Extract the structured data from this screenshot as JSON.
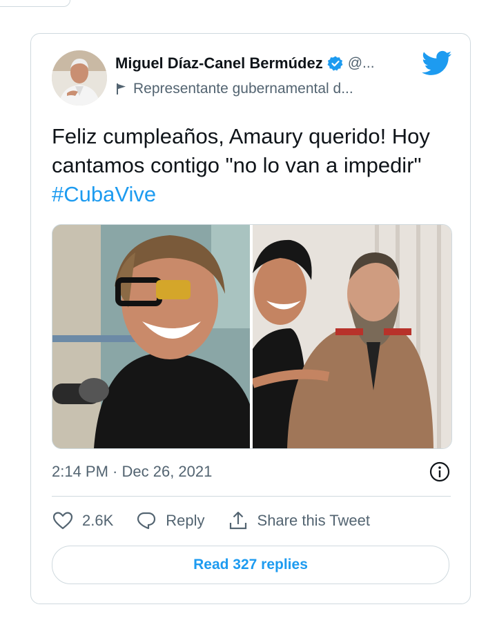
{
  "author": {
    "name": "Miguel Díaz-Canel Bermúdez",
    "handle": "@...",
    "label": "Representante gubernamental d..."
  },
  "tweet": {
    "text": "Feliz cumpleaños, Amaury querido! Hoy cantamos contigo \"no lo van a impedir\"",
    "hashtag": "#CubaVive",
    "timestamp": "2:14 PM · Dec 26, 2021"
  },
  "actions": {
    "likes": "2.6K",
    "reply": "Reply",
    "share": "Share this Tweet"
  },
  "read_replies": "Read 327 replies",
  "colors": {
    "accent": "#1d9bf0",
    "muted": "#536471",
    "border": "#cfd9de"
  },
  "icons": [
    "verified-badge-icon",
    "flag-icon",
    "twitter-bird-icon",
    "info-icon",
    "heart-icon",
    "reply-icon",
    "share-icon"
  ]
}
